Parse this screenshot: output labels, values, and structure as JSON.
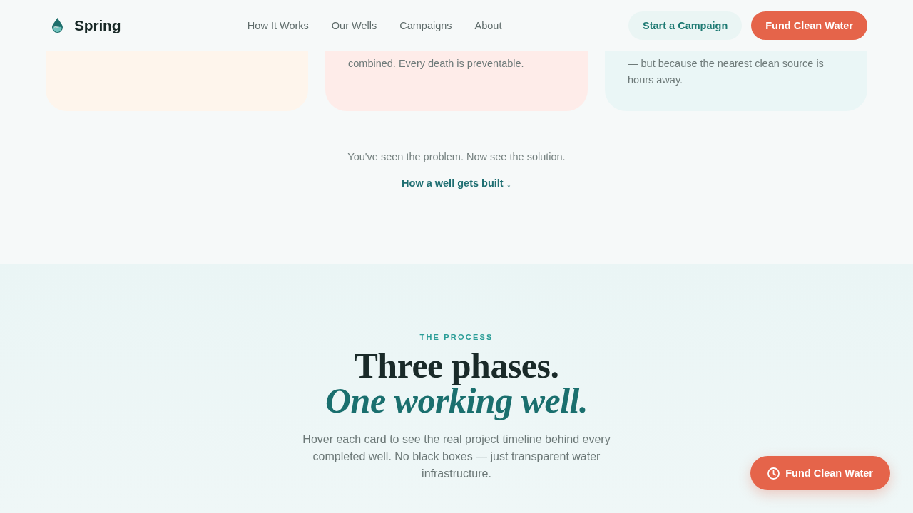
{
  "header": {
    "logo": {
      "name": "Spring"
    },
    "nav": [
      {
        "label": "How It Works"
      },
      {
        "label": "Our Wells"
      },
      {
        "label": "Campaigns"
      },
      {
        "label": "About"
      }
    ],
    "actions": [
      {
        "label": "Start a Campaign",
        "kind": "secondary"
      },
      {
        "label": "Fund Clean Water",
        "kind": "primary"
      }
    ]
  },
  "problem_cards": [
    {
      "color": "#fef5ec"
    },
    {
      "color": "#feece9",
      "text": "combined. Every death is preventable."
    },
    {
      "color": "#eaf6f6",
      "text": "— but because the nearest clean source is hours away."
    }
  ],
  "transition": {
    "text": "You've seen the problem. Now see the solution.",
    "link": "How a well gets built ↓"
  },
  "process": {
    "eyebrow": "THE PROCESS",
    "title": "Three phases.",
    "title_accent": "One working well.",
    "description": "Hover each card to see the real project timeline behind every completed well. No black boxes — just transparent water infrastructure."
  },
  "floating_button": {
    "label": "Fund Clean Water"
  }
}
